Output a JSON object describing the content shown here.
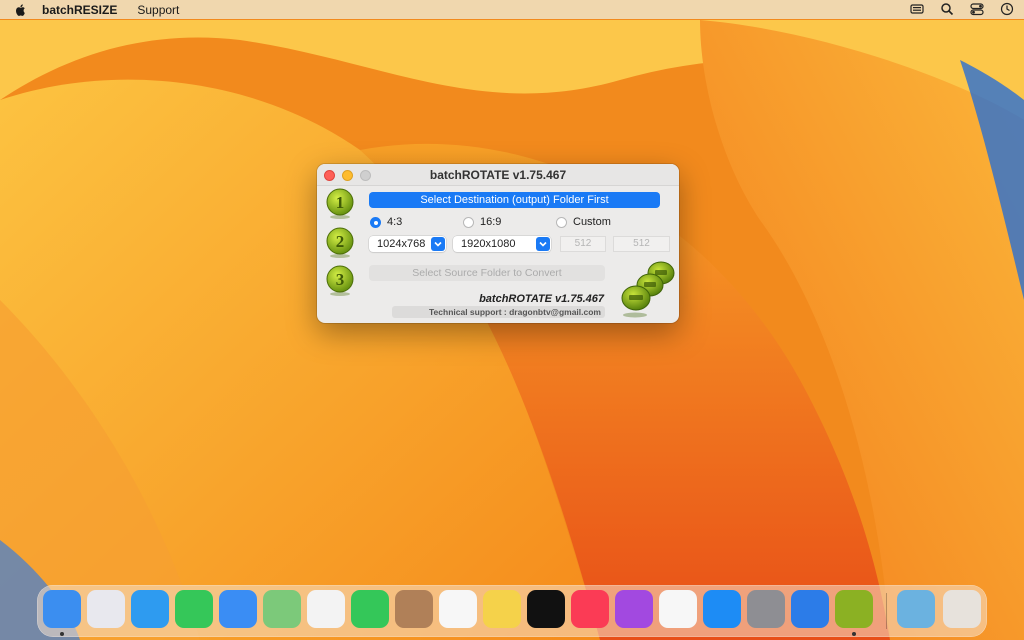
{
  "menubar": {
    "app_name": "batchRESIZE",
    "menu_items": [
      "Support"
    ]
  },
  "window": {
    "title": "batchROTATE v1.75.467",
    "step_labels": [
      "1",
      "2",
      "3"
    ],
    "select_destination_label": "Select Destination (output) Folder First",
    "aspect_options": [
      {
        "label": "4:3",
        "selected": true
      },
      {
        "label": "16:9",
        "selected": false
      },
      {
        "label": "Custom",
        "selected": false
      }
    ],
    "size_43_value": "1024x768",
    "size_169_value": "1920x1080",
    "custom_width_placeholder": "512",
    "custom_height_placeholder": "512",
    "select_source_label": "Select Source Folder to Convert",
    "signature": "batchROTATE v1.75.467",
    "support_text": "Technical support : dragonbtv@gmail.com"
  },
  "dock": {
    "items": [
      {
        "name": "finder-icon",
        "color": "#3b8ef0",
        "running": true
      },
      {
        "name": "launchpad-icon",
        "color": "#e8e8ee",
        "running": false
      },
      {
        "name": "safari-icon",
        "color": "#2e9bf0",
        "running": false
      },
      {
        "name": "messages-icon",
        "color": "#35c759",
        "running": false
      },
      {
        "name": "mail-icon",
        "color": "#3a8df4",
        "running": false
      },
      {
        "name": "maps-icon",
        "color": "#7cc97a",
        "running": false
      },
      {
        "name": "photos-icon",
        "color": "#f3f3f3",
        "running": false
      },
      {
        "name": "facetime-icon",
        "color": "#34c759",
        "running": false
      },
      {
        "name": "contacts-icon",
        "color": "#b08058",
        "running": false
      },
      {
        "name": "reminders-icon",
        "color": "#f7f7f7",
        "running": false
      },
      {
        "name": "notes-icon",
        "color": "#f5d24a",
        "running": false
      },
      {
        "name": "apple-tv-icon",
        "color": "#111111",
        "running": false
      },
      {
        "name": "music-icon",
        "color": "#fb3b55",
        "running": false
      },
      {
        "name": "podcasts-icon",
        "color": "#a249e0",
        "running": false
      },
      {
        "name": "news-icon",
        "color": "#f7f7f7",
        "running": false
      },
      {
        "name": "app-store-icon",
        "color": "#1d8cf5",
        "running": false
      },
      {
        "name": "system-settings-icon",
        "color": "#8e8e93",
        "running": false
      },
      {
        "name": "mountain-app-icon",
        "color": "#2c7ce8",
        "running": false
      },
      {
        "name": "batchresize-app-icon",
        "color": "#7fb21a",
        "running": true
      },
      {
        "name": "downloads-folder-icon",
        "color": "#5cb0ea",
        "running": false
      },
      {
        "name": "trash-icon",
        "color": "#e6e6e6",
        "running": false
      }
    ]
  }
}
